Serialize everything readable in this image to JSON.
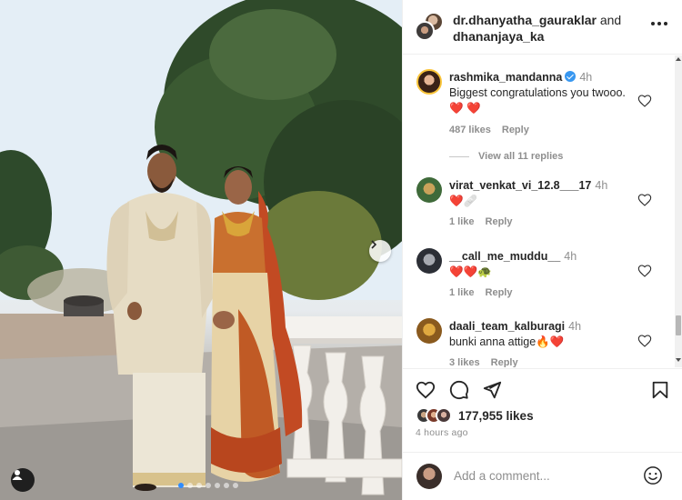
{
  "post": {
    "header": {
      "author1": "dr.dhanyatha_gauraklar",
      "joiner": "and",
      "author2": "dhananjaya_ka"
    },
    "comments": [
      {
        "user": "rashmika_mandanna",
        "verified": true,
        "time": "4h",
        "text": "Biggest congratulations you twooo. ❤️ ❤️",
        "likes": "487 likes",
        "reply": "Reply",
        "view_replies": "View all 11 replies"
      },
      {
        "user": "virat_venkat_vi_12.8___17",
        "time": "4h",
        "text": "❤️🩹",
        "likes": "1 like",
        "reply": "Reply"
      },
      {
        "user": "__call_me_muddu__",
        "time": "4h",
        "text": "❤️❤️🐢",
        "likes": "1 like",
        "reply": "Reply"
      },
      {
        "user": "daali_team_kalburagi",
        "time": "4h",
        "text": "bunki anna attige🔥❤️",
        "likes": "3 likes",
        "reply": "Reply"
      }
    ],
    "likes_total": "177,955 likes",
    "posted": "4 hours ago",
    "add_comment_placeholder": "Add a comment...",
    "carousel": {
      "total": 7,
      "current": 1
    }
  },
  "icons": {
    "like": "heart-icon",
    "comment": "comment-bubble-icon",
    "share": "paper-plane-icon",
    "save": "bookmark-icon",
    "next": "chevron-right-icon",
    "tagged": "user-tag-icon",
    "emoji": "smiley-icon",
    "more": "more-horizontal-icon"
  },
  "colors": {
    "verified": "#3897f0",
    "heart_red": "#ed4956",
    "muted_text": "#8e8e8e",
    "carousel_active": "#2f8cff"
  }
}
